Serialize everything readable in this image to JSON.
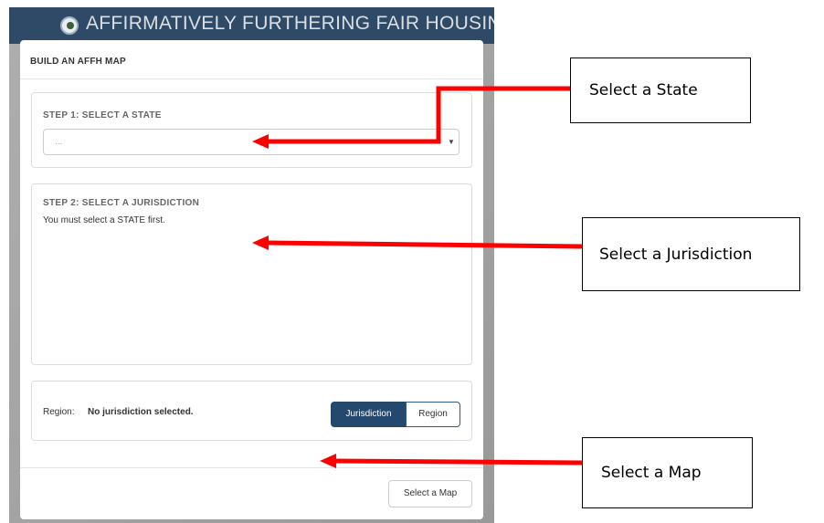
{
  "app": {
    "title": "AFFIRMATIVELY FURTHERING FAIR HOUSING"
  },
  "modal": {
    "title": "BUILD AN AFFH MAP",
    "step1": {
      "title": "STEP 1: SELECT A STATE",
      "select_value": "..."
    },
    "step2": {
      "title": "STEP 2: SELECT A JURISDICTION",
      "message": "You must select a STATE first."
    },
    "region": {
      "label": "Region:",
      "value": "No jurisdiction selected.",
      "toggle": {
        "jurisdiction_label": "Jurisdiction",
        "region_label": "Region",
        "active": "Jurisdiction"
      }
    },
    "footer": {
      "select_map_label": "Select a Map"
    }
  },
  "annotations": {
    "select_state": "Select a State",
    "select_jurisdiction": "Select a Jurisdiction",
    "select_map": "Select a Map",
    "arrow_color": "#ff0000"
  },
  "colors": {
    "header_bg": "#2f4a66",
    "toggle_active_bg": "#24486e"
  }
}
